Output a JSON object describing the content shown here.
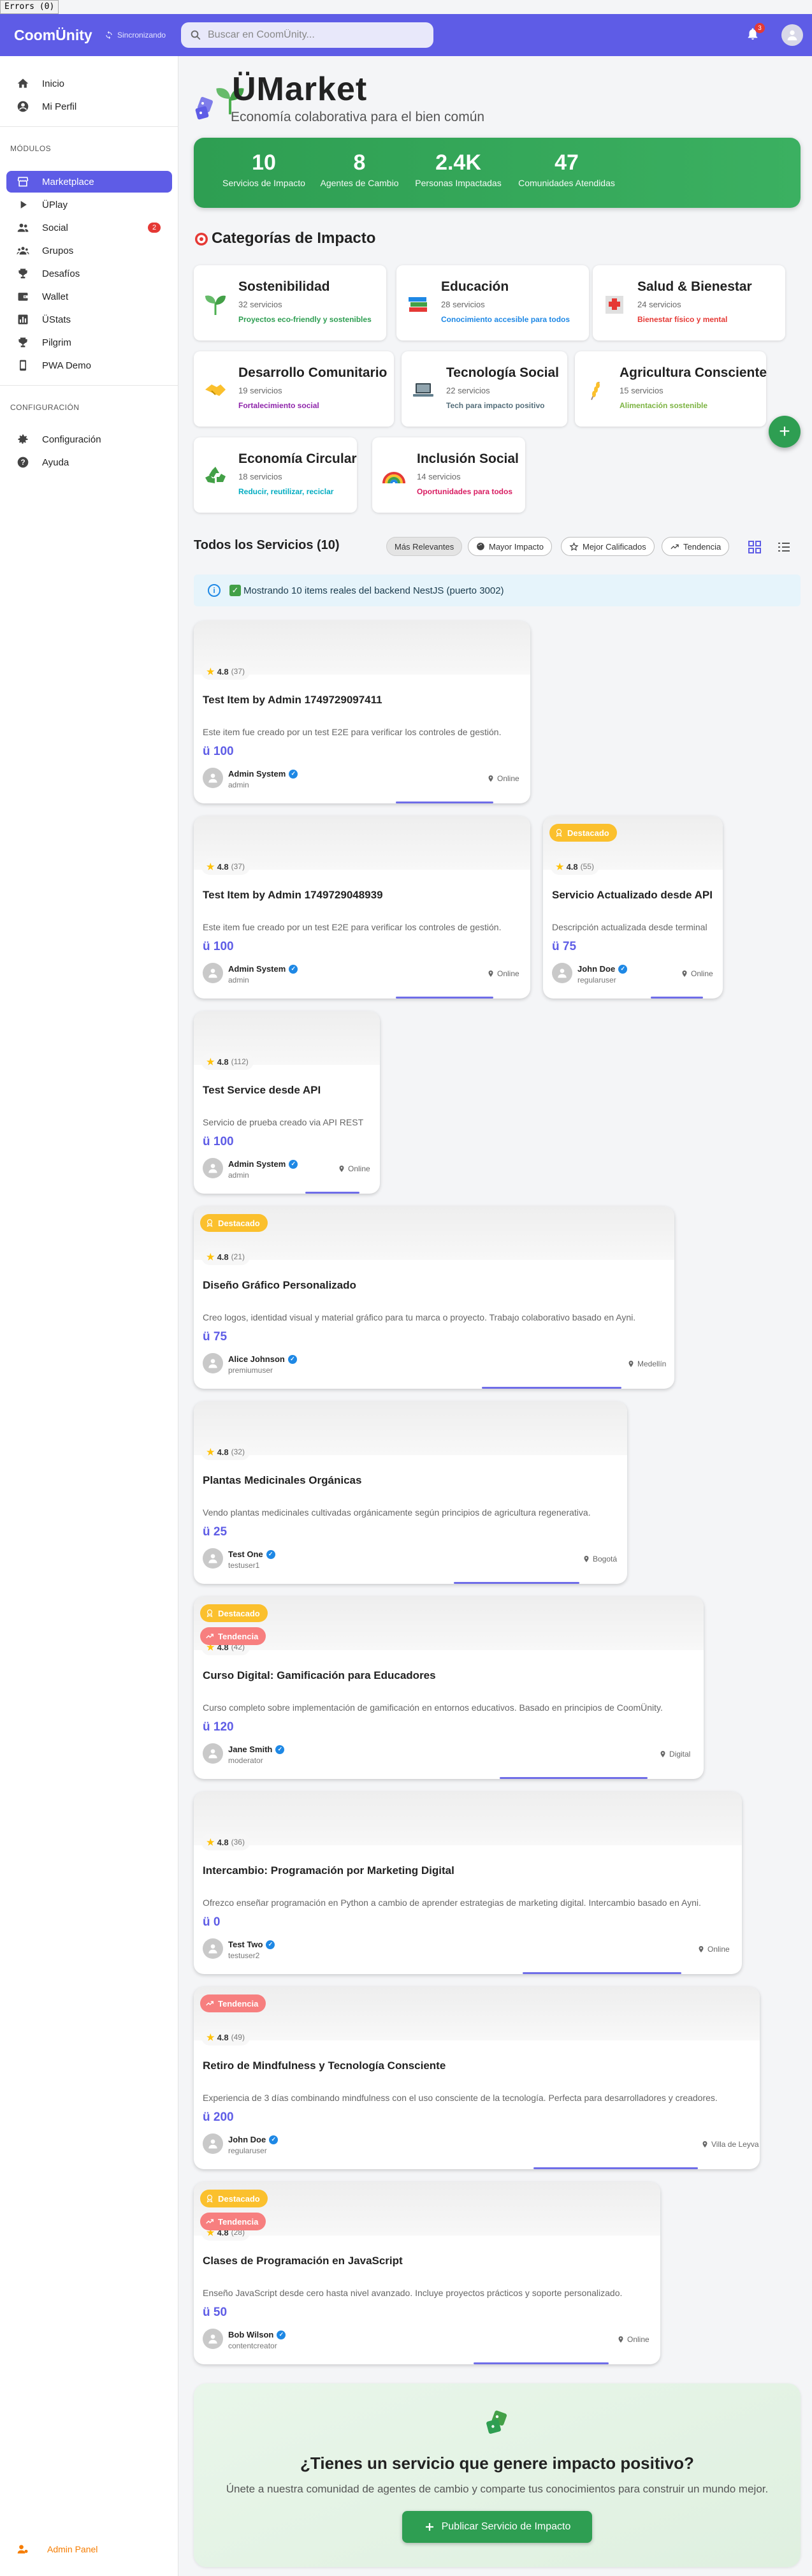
{
  "window": {
    "errors_tab": "Errors (0)"
  },
  "appbar": {
    "brand": "CoomÜnity",
    "sync_label": "Sincronizando",
    "search_placeholder": "Buscar en CoomÜnity...",
    "notifications_count": "3"
  },
  "sidebar": {
    "items": [
      {
        "label": "Inicio",
        "icon": "home-icon"
      },
      {
        "label": "Mi Perfil",
        "icon": "account-circle-icon"
      }
    ],
    "modules_title": "MÓDULOS",
    "modules": [
      {
        "label": "Marketplace",
        "icon": "storefront-icon",
        "active": true
      },
      {
        "label": "ÜPlay",
        "icon": "play-arrow-icon"
      },
      {
        "label": "Social",
        "icon": "people-icon",
        "badge": "2"
      },
      {
        "label": "Grupos",
        "icon": "groups-icon"
      },
      {
        "label": "Desafíos",
        "icon": "trophy-icon"
      },
      {
        "label": "Wallet",
        "icon": "wallet-icon"
      },
      {
        "label": "ÜStats",
        "icon": "bar-chart-icon"
      },
      {
        "label": "Pilgrim",
        "icon": "trophy-icon"
      },
      {
        "label": "PWA Demo",
        "icon": "phone-icon"
      }
    ],
    "config_title": "CONFIGURACIÓN",
    "config": [
      {
        "label": "Configuración",
        "icon": "gear-icon"
      },
      {
        "label": "Ayuda",
        "icon": "help-icon"
      }
    ],
    "admin_panel": "Admin Panel"
  },
  "header": {
    "title": "ÜMarket",
    "subtitle": "Economía colaborativa para el bien común"
  },
  "stats": [
    {
      "value": "10",
      "label": "Servicios de Impacto"
    },
    {
      "value": "8",
      "label": "Agentes de Cambio"
    },
    {
      "value": "2.4K",
      "label": "Personas Impactadas"
    },
    {
      "value": "47",
      "label": "Comunidades Atendidas"
    }
  ],
  "categories_title": "Categorías de Impacto",
  "categories": [
    {
      "name": "Sostenibilidad",
      "count": "32 servicios",
      "desc": "Proyectos eco-friendly y sostenibles",
      "color": "#2e9e52",
      "icon": "seedling-icon"
    },
    {
      "name": "Educación",
      "count": "28 servicios",
      "desc": "Conocimiento accesible para todos",
      "color": "#1e88e5",
      "icon": "books-icon"
    },
    {
      "name": "Salud & Bienestar",
      "count": "24 servicios",
      "desc": "Bienestar físico y mental",
      "color": "#e53935",
      "icon": "hospital-icon"
    },
    {
      "name": "Desarrollo Comunitario",
      "count": "19 servicios",
      "desc": "Fortalecimiento social",
      "color": "#8e24aa",
      "icon": "handshake-icon"
    },
    {
      "name": "Tecnología Social",
      "count": "22 servicios",
      "desc": "Tech para impacto positivo",
      "color": "#546e7a",
      "icon": "laptop-icon"
    },
    {
      "name": "Agricultura Consciente",
      "count": "15 servicios",
      "desc": "Alimentación sostenible",
      "color": "#7cb342",
      "icon": "wheat-icon"
    },
    {
      "name": "Economía Circular",
      "count": "18 servicios",
      "desc": "Reducir, reutilizar, reciclar",
      "color": "#00acc1",
      "icon": "recycle-icon"
    },
    {
      "name": "Inclusión Social",
      "count": "14 servicios",
      "desc": "Oportunidades para todos",
      "color": "#d81b60",
      "icon": "rainbow-icon"
    }
  ],
  "services_header": {
    "title": "Todos los Servicios (10)",
    "chips": [
      "Más Relevantes",
      "Mayor Impacto",
      "Mejor Calificados",
      "Tendencia"
    ]
  },
  "info_banner": "Mostrando 10 items reales del backend NestJS (puerto 3002)",
  "services": [
    {
      "title": "Test Item by Admin 1749729097411",
      "desc": "Este item fue creado por un test E2E para verificar los controles de gestión.",
      "price": "ü 100",
      "rating": "4.8",
      "reviews": "(37)",
      "provider": "Admin System",
      "username": "admin",
      "location": "Online",
      "badges": []
    },
    {
      "title": "Test Item by Admin 1749729048939",
      "desc": "Este item fue creado por un test E2E para verificar los controles de gestión.",
      "price": "ü 100",
      "rating": "4.8",
      "reviews": "(37)",
      "provider": "Admin System",
      "username": "admin",
      "location": "Online",
      "badges": []
    },
    {
      "title": "Servicio Actualizado desde API",
      "desc": "Descripción actualizada desde terminal",
      "price": "ü 75",
      "rating": "4.8",
      "reviews": "(55)",
      "provider": "John Doe",
      "username": "regularuser",
      "location": "Online",
      "badges": [
        "Destacado"
      ]
    },
    {
      "title": "Test Service desde API",
      "desc": "Servicio de prueba creado via API REST",
      "price": "ü 100",
      "rating": "4.8",
      "reviews": "(112)",
      "provider": "Admin System",
      "username": "admin",
      "location": "Online",
      "badges": []
    },
    {
      "title": "Diseño Gráfico Personalizado",
      "desc": "Creo logos, identidad visual y material gráfico para tu marca o proyecto. Trabajo colaborativo basado en Ayni.",
      "price": "ü 75",
      "rating": "4.8",
      "reviews": "(21)",
      "provider": "Alice Johnson",
      "username": "premiumuser",
      "location": "Medellín",
      "badges": [
        "Destacado"
      ]
    },
    {
      "title": "Plantas Medicinales Orgánicas",
      "desc": "Vendo plantas medicinales cultivadas orgánicamente según principios de agricultura regenerativa.",
      "price": "ü 25",
      "rating": "4.8",
      "reviews": "(32)",
      "provider": "Test One",
      "username": "testuser1",
      "location": "Bogotá",
      "badges": []
    },
    {
      "title": "Curso Digital: Gamificación para Educadores",
      "desc": "Curso completo sobre implementación de gamificación en entornos educativos. Basado en principios de CoomÜnity.",
      "price": "ü 120",
      "rating": "4.8",
      "reviews": "(42)",
      "provider": "Jane Smith",
      "username": "moderator",
      "location": "Digital",
      "badges": [
        "Destacado",
        "Tendencia"
      ]
    },
    {
      "title": "Intercambio: Programación por Marketing Digital",
      "desc": "Ofrezco enseñar programación en Python a cambio de aprender estrategias de marketing digital. Intercambio basado en Ayni.",
      "price": "ü 0",
      "rating": "4.8",
      "reviews": "(36)",
      "provider": "Test Two",
      "username": "testuser2",
      "location": "Online",
      "badges": []
    },
    {
      "title": "Retiro de Mindfulness y Tecnología Consciente",
      "desc": "Experiencia de 3 días combinando mindfulness con el uso consciente de la tecnología. Perfecta para desarrolladores y creadores.",
      "price": "ü 200",
      "rating": "4.8",
      "reviews": "(49)",
      "provider": "John Doe",
      "username": "regularuser",
      "location": "Villa de Leyva",
      "badges": [
        "Tendencia"
      ]
    },
    {
      "title": "Clases de Programación en JavaScript",
      "desc": "Enseño JavaScript desde cero hasta nivel avanzado. Incluye proyectos prácticos y soporte personalizado.",
      "price": "ü 50",
      "rating": "4.8",
      "reviews": "(28)",
      "provider": "Bob Wilson",
      "username": "contentcreator",
      "location": "Online",
      "badges": [
        "Destacado",
        "Tendencia"
      ]
    }
  ],
  "cta": {
    "title": "¿Tienes un servicio que genere impacto positivo?",
    "subtitle": "Únete a nuestra comunidad de agentes de cambio y comparte tus conocimientos para construir un mundo mejor.",
    "button": "Publicar Servicio de Impacto"
  },
  "colors": {
    "primary": "#5e5ce6",
    "green": "#2e9e52",
    "featured": "#fbc02d",
    "trend": "#f77f7f"
  }
}
